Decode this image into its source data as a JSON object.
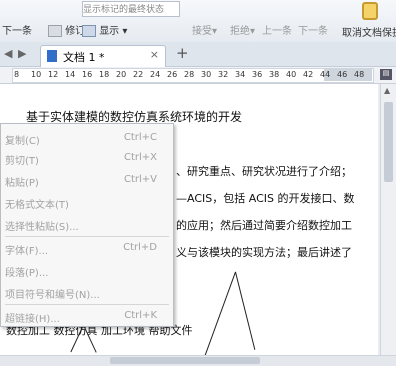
{
  "toolbar": {
    "previous": "下一条",
    "revise": "修订",
    "show_markup_dropdown": "显示标记的最终状态",
    "show": "显示",
    "accept": "接受",
    "reject": "拒绝",
    "prev_item": "上一条",
    "next_item": "下一条",
    "cancel_protect": "取消文档保护"
  },
  "tabs": {
    "doc_name": "文档 1 *",
    "close": "×",
    "add": "+"
  },
  "ruler": {
    "numbers": [
      "8",
      "10",
      "12",
      "14",
      "16",
      "18",
      "20",
      "22",
      "24",
      "26",
      "28",
      "30",
      "32",
      "34",
      "36",
      "38",
      "40",
      "42",
      "44",
      "46",
      "48"
    ]
  },
  "document": {
    "title": "基于实体建模的数控仿真系统环境的开发",
    "line1": "、研究重点、研究状况进行了介绍；",
    "line2": "—ACIS，包括 ACIS 的开发接口、数",
    "line3": "的应用；然后通过简要介绍数控加工",
    "line4": "义与该模块的实现方法；最后讲述了",
    "keywords": "数控加工   数控仿真   加工环境   帮助文件"
  },
  "context_menu": {
    "items": [
      {
        "label": "复制(C)",
        "shortcut": "Ctrl+C"
      },
      {
        "label": "剪切(T)",
        "shortcut": "Ctrl+X"
      },
      {
        "label": "粘贴(P)",
        "shortcut": "Ctrl+V"
      },
      {
        "label": "无格式文本(T)",
        "shortcut": ""
      },
      {
        "label": "选择性粘贴(S)...",
        "shortcut": ""
      },
      {
        "label": "字体(F)...",
        "shortcut": "Ctrl+D"
      },
      {
        "label": "段落(P)...",
        "shortcut": ""
      },
      {
        "label": "项目符号和编号(N)...",
        "shortcut": ""
      },
      {
        "label": "超链接(H)...",
        "shortcut": "Ctrl+K"
      }
    ]
  }
}
